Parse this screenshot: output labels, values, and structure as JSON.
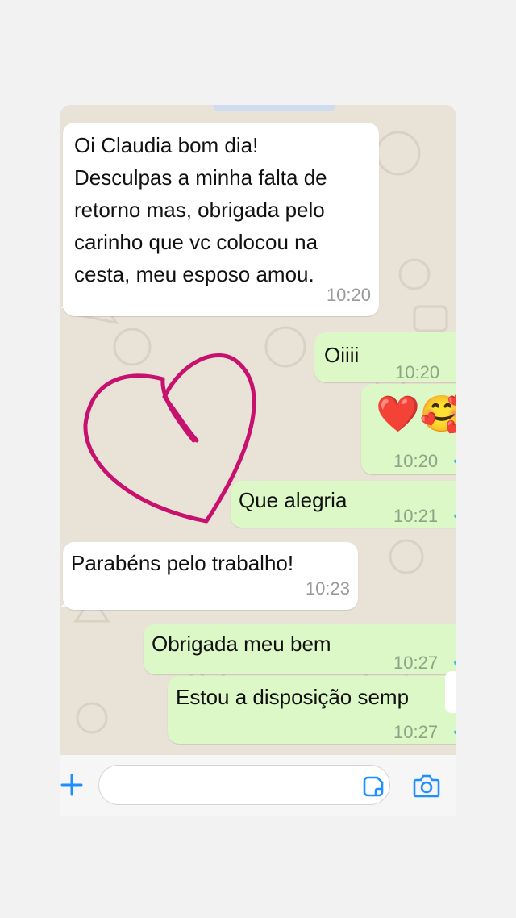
{
  "messages": [
    {
      "direction": "incoming",
      "text": "Oi Claudia bom dia!\nDesculpas a minha falta de\nretorno mas, obrigada pelo\ncarinho que vc colocou na\ncesta, meu esposo amou.",
      "time": "10:20"
    },
    {
      "direction": "outgoing",
      "text": "Oiiii",
      "time": "10:20"
    },
    {
      "direction": "outgoing",
      "text": "❤️🥰",
      "time": "10:20"
    },
    {
      "direction": "outgoing",
      "text": "Que alegria",
      "time": "10:21"
    },
    {
      "direction": "incoming",
      "text": "Parabéns pelo trabalho!",
      "time": "10:23"
    },
    {
      "direction": "outgoing",
      "text": "Obrigada meu bem",
      "time": "10:27"
    },
    {
      "direction": "outgoing",
      "text": "Estou a disposição semp",
      "time": "10:27"
    }
  ],
  "read_receipt": "✓",
  "input_bar": {
    "placeholder": "",
    "icons": [
      "plus-icon",
      "sticker-icon",
      "camera-icon"
    ]
  },
  "colors": {
    "accent": "#1f8fff",
    "incoming_bubble": "#ffffff",
    "outgoing_bubble": "#dcf8c6",
    "wallpaper": "#e9e2d6",
    "heart_drawing": "#c8106e"
  }
}
